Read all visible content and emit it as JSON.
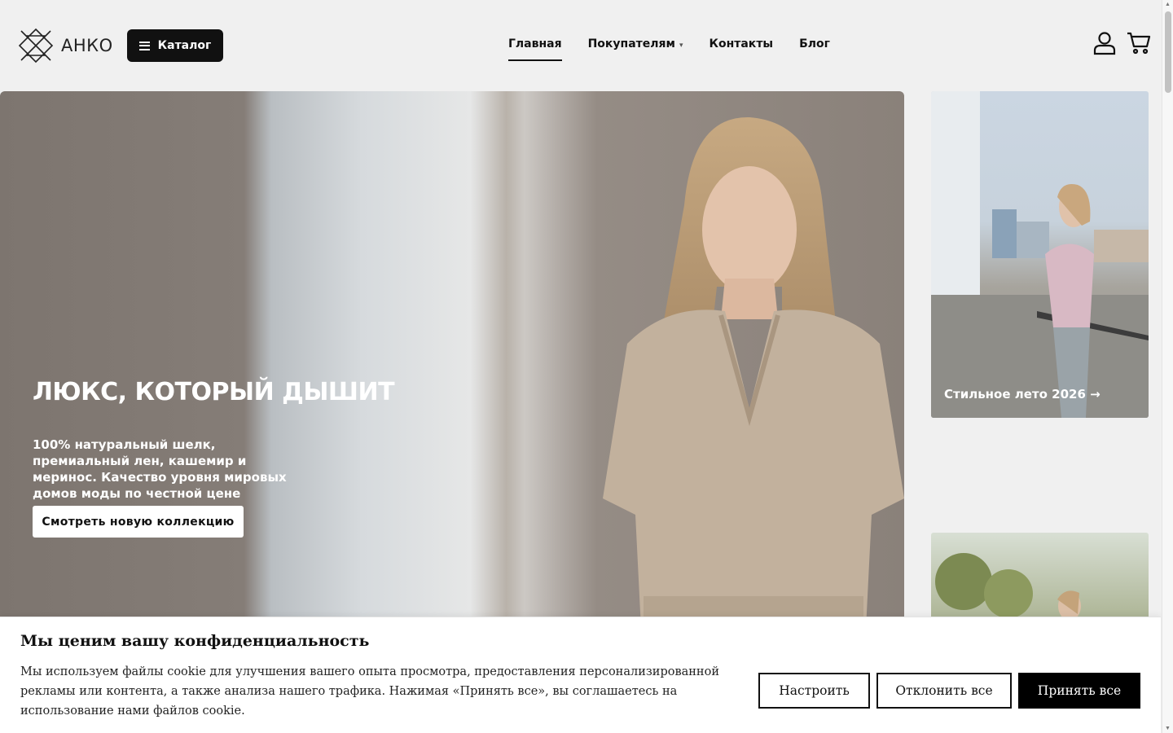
{
  "header": {
    "logo_text": "АНКО",
    "catalog_label": "Каталог",
    "nav": [
      {
        "label": "Главная",
        "active": true
      },
      {
        "label": "Покупателям",
        "has_dropdown": true
      },
      {
        "label": "Контакты"
      },
      {
        "label": "Блог"
      }
    ],
    "caret_glyph": "▾",
    "icons": [
      "user-icon",
      "cart-icon"
    ]
  },
  "hero": {
    "title": "ЛЮКС, КОТОРЫЙ ДЫШИТ",
    "text": "100% натуральный шелк,  премиальный лен, кашемир и меринос. Качество уровня мировых домов моды по честной цене",
    "cta": "Смотреть новую коллекцию"
  },
  "side_cards": [
    {
      "label": "Стильное лето 2026 →"
    },
    {
      "label": ""
    }
  ],
  "cookie": {
    "title": "Мы ценим вашу конфиденциальность",
    "text": "Мы используем файлы cookie для улучшения вашего опыта просмотра, предоставления персонализированной рекламы или контента, а также анализа нашего трафика. Нажимая «Принять все», вы соглашаетесь на использование нами файлов cookie.",
    "customize": "Настроить",
    "reject": "Отклонить все",
    "accept": "Принять все"
  },
  "colors": {
    "primary": "#111111",
    "background": "#f0f0f0",
    "white": "#ffffff"
  }
}
